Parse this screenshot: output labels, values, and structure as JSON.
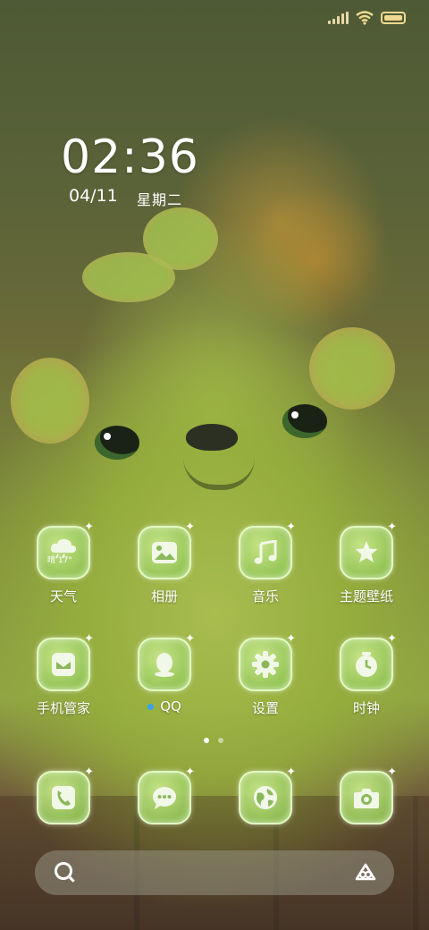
{
  "status": {
    "icons": [
      "signal-icon",
      "wifi-icon",
      "battery-icon"
    ]
  },
  "lockscreen": {
    "time": "02:36",
    "date": "04/11",
    "weekday": "星期二"
  },
  "apps_row1": [
    {
      "label": "天气",
      "icon": "weather-icon",
      "weather_text": "晴 17°"
    },
    {
      "label": "相册",
      "icon": "gallery-icon"
    },
    {
      "label": "音乐",
      "icon": "music-icon"
    },
    {
      "label": "主题壁纸",
      "icon": "theme-icon"
    }
  ],
  "apps_row2": [
    {
      "label": "手机管家",
      "icon": "security-icon"
    },
    {
      "label": "QQ",
      "icon": "qq-icon"
    },
    {
      "label": "设置",
      "icon": "settings-icon"
    },
    {
      "label": "时钟",
      "icon": "clock-icon"
    }
  ],
  "dock": [
    {
      "icon": "phone-icon"
    },
    {
      "icon": "messages-icon"
    },
    {
      "icon": "browser-icon"
    },
    {
      "icon": "camera-icon"
    }
  ],
  "pages": {
    "count": 2,
    "active": 1
  },
  "colors": {
    "accent": "#b4d46a",
    "qq_dot": "#3aa0f0"
  }
}
